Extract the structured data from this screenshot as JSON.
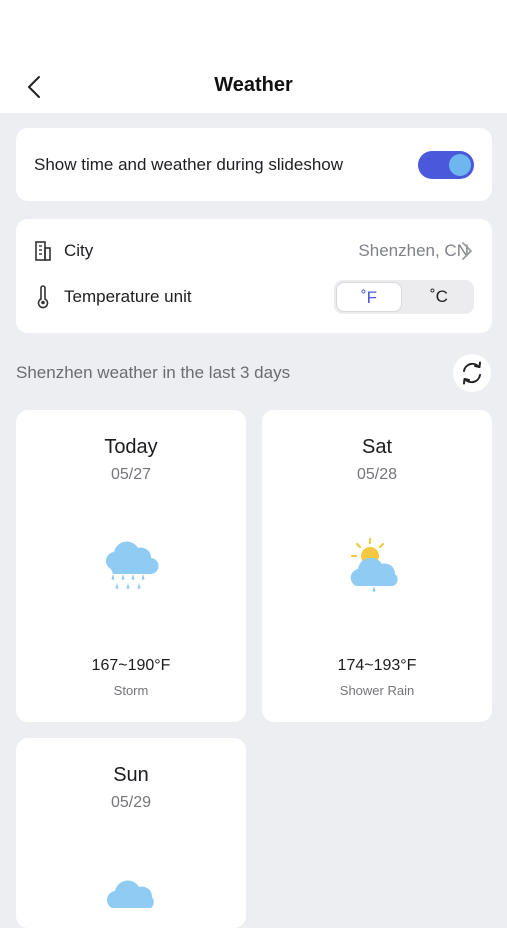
{
  "header": {
    "title": "Weather",
    "back_icon": "chevron-left-icon"
  },
  "slideshow": {
    "label": "Show time and weather during slideshow",
    "enabled": true
  },
  "settings": {
    "city_label": "City",
    "city_value": "Shenzhen, CN",
    "temp_label": "Temperature unit",
    "unit_f": "˚F",
    "unit_c": "˚C",
    "selected_unit": "F"
  },
  "section": {
    "title": "Shenzhen weather in the last 3 days",
    "refresh_icon": "refresh-icon"
  },
  "days": [
    {
      "name": "Today",
      "date": "05/27",
      "temp": "167~190°F",
      "desc": "Storm",
      "icon": "rain-cloud-icon"
    },
    {
      "name": "Sat",
      "date": "05/28",
      "temp": "174~193°F",
      "desc": "Shower Rain",
      "icon": "sun-cloud-icon"
    },
    {
      "name": "Sun",
      "date": "05/29",
      "temp": "",
      "desc": "",
      "icon": "cloud-icon"
    }
  ],
  "colors": {
    "accent": "#4a58db",
    "toggle_knob": "#6eb6f0",
    "cloud": "#8fcbf2",
    "sun": "#f5c842"
  }
}
